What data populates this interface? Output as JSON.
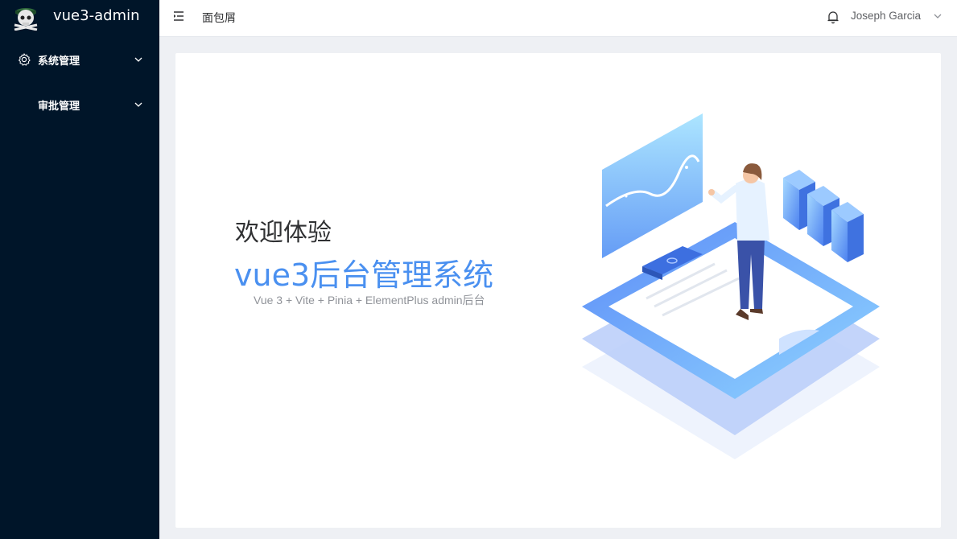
{
  "app": {
    "title": "vue3-admin"
  },
  "sidebar": {
    "items": [
      {
        "label": "系统管理",
        "icon": "gear-icon"
      },
      {
        "label": "审批管理",
        "icon": ""
      }
    ]
  },
  "header": {
    "breadcrumb": "面包屑",
    "user_name": "Joseph Garcia"
  },
  "main": {
    "welcome": "欢迎体验",
    "system_title": "vue3后台管理系统",
    "subtitle": "Vue 3 + Vite + Pinia + ElementPlus admin后台"
  },
  "colors": {
    "sidebar_bg": "#001529",
    "accent": "#4a90f0",
    "content_bg": "#eef0f4"
  }
}
